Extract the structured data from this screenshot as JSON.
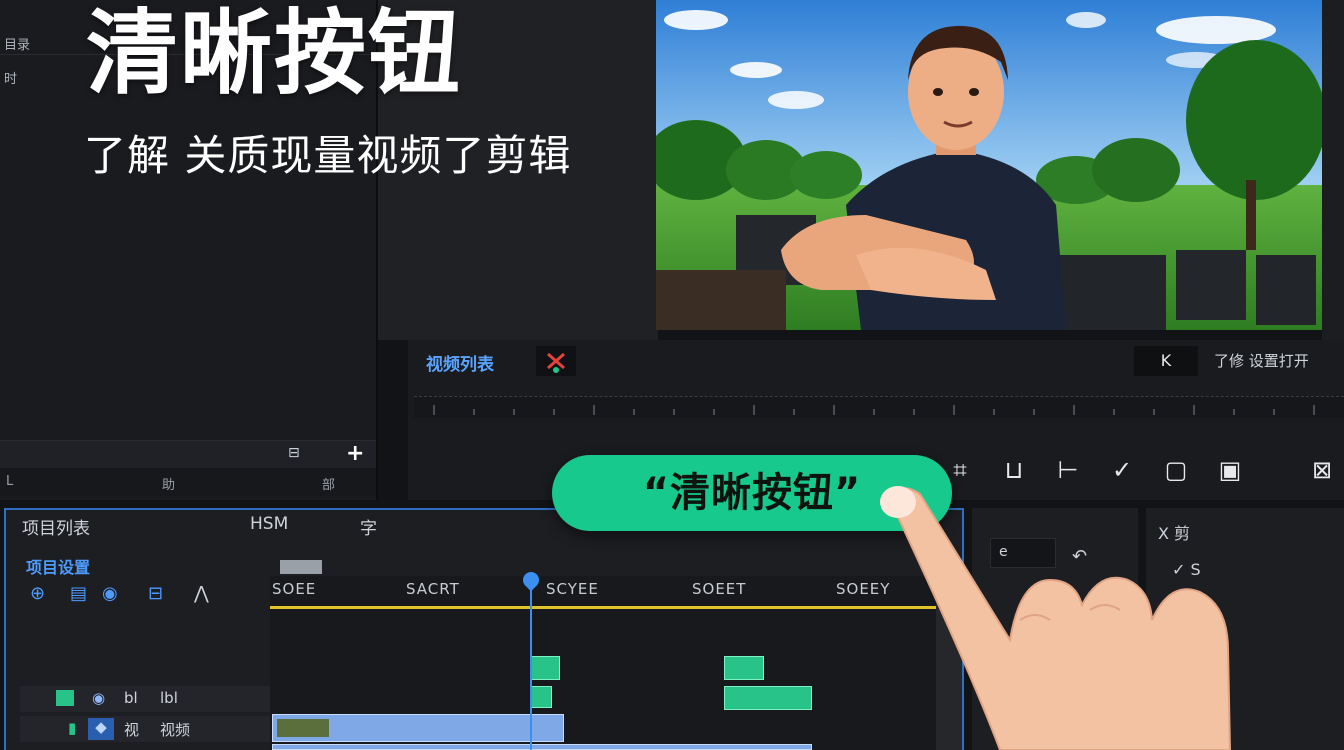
{
  "overlay": {
    "title": "清晰按钮",
    "subtitle": "了解 关质现量视频了剪辑",
    "callout": "“清晰按钮”"
  },
  "left_panel": {
    "top_labels": [
      "目录",
      "时"
    ],
    "bottom_tabs": [
      "L",
      "助",
      "部"
    ],
    "add_symbol": "+"
  },
  "transport": {
    "label": "视频列表",
    "right_text": "了修 设置打开",
    "box_symbol": "K"
  },
  "toolbar": {
    "icons": [
      "crop-icon",
      "export-icon",
      "trim-icon",
      "check-icon",
      "square-icon",
      "save-icon",
      "split-icon"
    ],
    "glyphs": [
      "⌗",
      "⊔",
      "⊢",
      "✓",
      "▢",
      "▣",
      "⊠"
    ]
  },
  "timeline": {
    "header": "项目列表",
    "header2": "HSM",
    "header3": "字",
    "blue_label": "项目设置",
    "tool_glyphs": [
      "⊕",
      "▤",
      "◉",
      "⊟",
      "⋀"
    ],
    "ruler_labels": [
      "SOEE",
      "SACRT",
      "SCYEE",
      "SOEET",
      "SOEEY"
    ],
    "tracks": [
      {
        "name": "bl",
        "label": "lbl"
      },
      {
        "name": "视",
        "label": "视频"
      }
    ]
  },
  "right_panel": {
    "field_value": "e",
    "label1": "X 剪",
    "label2": "✓ S"
  },
  "colors": {
    "accent_green": "#17c98c",
    "accent_blue": "#3b8ff0",
    "timeline_yellow": "#e2c22b"
  }
}
